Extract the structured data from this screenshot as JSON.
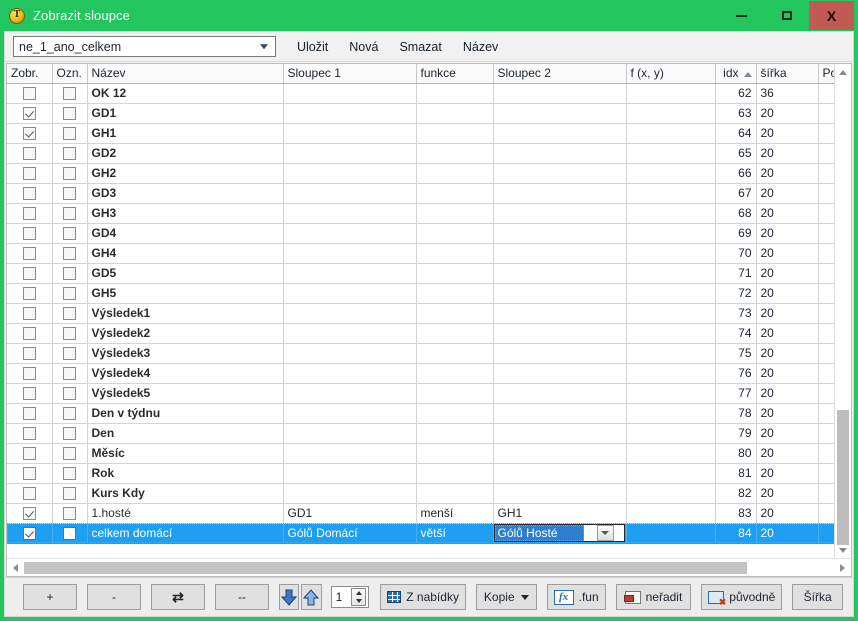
{
  "window": {
    "title": "Zobrazit sloupce",
    "icon": "coin-t-icon",
    "accent_green": "#22c55e",
    "selection_blue": "#1e9ff2",
    "buttons": {
      "minimize": "minimize-icon",
      "maximize": "maximize-icon",
      "close": "close-icon",
      "close_label": "X"
    }
  },
  "toolbar": {
    "profile_combo_value": "ne_1_ano_celkem",
    "save_label": "Uložit",
    "new_label": "Nová",
    "delete_label": "Smazat",
    "name_label": "Název"
  },
  "grid": {
    "columns": [
      {
        "key": "zobr",
        "label": "Zobr.",
        "align": "left"
      },
      {
        "key": "ozn",
        "label": "Ozn.",
        "align": "left"
      },
      {
        "key": "nazev",
        "label": "Název",
        "align": "left"
      },
      {
        "key": "s1",
        "label": "Sloupec 1",
        "align": "left"
      },
      {
        "key": "fn",
        "label": "funkce",
        "align": "left"
      },
      {
        "key": "s2",
        "label": "Sloupec 2",
        "align": "left"
      },
      {
        "key": "fxy",
        "label": "f (x, y)",
        "align": "left"
      },
      {
        "key": "idx",
        "label": "idx",
        "align": "right",
        "sorted": "asc"
      },
      {
        "key": "sirka",
        "label": "šířka",
        "align": "left"
      },
      {
        "key": "po",
        "label": "Po",
        "align": "left"
      }
    ],
    "rows": [
      {
        "zobr": false,
        "ozn": false,
        "nazev": "OK 12",
        "s1": "",
        "fn": "",
        "s2": "",
        "fxy": "",
        "idx": "62",
        "sirka": "36",
        "po": "",
        "bold": true,
        "selected": false
      },
      {
        "zobr": true,
        "ozn": false,
        "nazev": "GD1",
        "s1": "",
        "fn": "",
        "s2": "",
        "fxy": "",
        "idx": "63",
        "sirka": "20",
        "po": "",
        "bold": true,
        "selected": false
      },
      {
        "zobr": true,
        "ozn": false,
        "nazev": "GH1",
        "s1": "",
        "fn": "",
        "s2": "",
        "fxy": "",
        "idx": "64",
        "sirka": "20",
        "po": "",
        "bold": true,
        "selected": false
      },
      {
        "zobr": false,
        "ozn": false,
        "nazev": "GD2",
        "s1": "",
        "fn": "",
        "s2": "",
        "fxy": "",
        "idx": "65",
        "sirka": "20",
        "po": "",
        "bold": true,
        "selected": false
      },
      {
        "zobr": false,
        "ozn": false,
        "nazev": "GH2",
        "s1": "",
        "fn": "",
        "s2": "",
        "fxy": "",
        "idx": "66",
        "sirka": "20",
        "po": "",
        "bold": true,
        "selected": false
      },
      {
        "zobr": false,
        "ozn": false,
        "nazev": "GD3",
        "s1": "",
        "fn": "",
        "s2": "",
        "fxy": "",
        "idx": "67",
        "sirka": "20",
        "po": "",
        "bold": true,
        "selected": false
      },
      {
        "zobr": false,
        "ozn": false,
        "nazev": "GH3",
        "s1": "",
        "fn": "",
        "s2": "",
        "fxy": "",
        "idx": "68",
        "sirka": "20",
        "po": "",
        "bold": true,
        "selected": false
      },
      {
        "zobr": false,
        "ozn": false,
        "nazev": "GD4",
        "s1": "",
        "fn": "",
        "s2": "",
        "fxy": "",
        "idx": "69",
        "sirka": "20",
        "po": "",
        "bold": true,
        "selected": false
      },
      {
        "zobr": false,
        "ozn": false,
        "nazev": "GH4",
        "s1": "",
        "fn": "",
        "s2": "",
        "fxy": "",
        "idx": "70",
        "sirka": "20",
        "po": "",
        "bold": true,
        "selected": false
      },
      {
        "zobr": false,
        "ozn": false,
        "nazev": "GD5",
        "s1": "",
        "fn": "",
        "s2": "",
        "fxy": "",
        "idx": "71",
        "sirka": "20",
        "po": "",
        "bold": true,
        "selected": false
      },
      {
        "zobr": false,
        "ozn": false,
        "nazev": "GH5",
        "s1": "",
        "fn": "",
        "s2": "",
        "fxy": "",
        "idx": "72",
        "sirka": "20",
        "po": "",
        "bold": true,
        "selected": false
      },
      {
        "zobr": false,
        "ozn": false,
        "nazev": "Výsledek1",
        "s1": "",
        "fn": "",
        "s2": "",
        "fxy": "",
        "idx": "73",
        "sirka": "20",
        "po": "",
        "bold": true,
        "selected": false
      },
      {
        "zobr": false,
        "ozn": false,
        "nazev": "Výsledek2",
        "s1": "",
        "fn": "",
        "s2": "",
        "fxy": "",
        "idx": "74",
        "sirka": "20",
        "po": "",
        "bold": true,
        "selected": false
      },
      {
        "zobr": false,
        "ozn": false,
        "nazev": "Výsledek3",
        "s1": "",
        "fn": "",
        "s2": "",
        "fxy": "",
        "idx": "75",
        "sirka": "20",
        "po": "",
        "bold": true,
        "selected": false
      },
      {
        "zobr": false,
        "ozn": false,
        "nazev": "Výsledek4",
        "s1": "",
        "fn": "",
        "s2": "",
        "fxy": "",
        "idx": "76",
        "sirka": "20",
        "po": "",
        "bold": true,
        "selected": false
      },
      {
        "zobr": false,
        "ozn": false,
        "nazev": "Výsledek5",
        "s1": "",
        "fn": "",
        "s2": "",
        "fxy": "",
        "idx": "77",
        "sirka": "20",
        "po": "",
        "bold": true,
        "selected": false
      },
      {
        "zobr": false,
        "ozn": false,
        "nazev": "Den v týdnu",
        "s1": "",
        "fn": "",
        "s2": "",
        "fxy": "",
        "idx": "78",
        "sirka": "20",
        "po": "",
        "bold": true,
        "selected": false
      },
      {
        "zobr": false,
        "ozn": false,
        "nazev": "Den",
        "s1": "",
        "fn": "",
        "s2": "",
        "fxy": "",
        "idx": "79",
        "sirka": "20",
        "po": "",
        "bold": true,
        "selected": false
      },
      {
        "zobr": false,
        "ozn": false,
        "nazev": "Měsíc",
        "s1": "",
        "fn": "",
        "s2": "",
        "fxy": "",
        "idx": "80",
        "sirka": "20",
        "po": "",
        "bold": true,
        "selected": false
      },
      {
        "zobr": false,
        "ozn": false,
        "nazev": "Rok",
        "s1": "",
        "fn": "",
        "s2": "",
        "fxy": "",
        "idx": "81",
        "sirka": "20",
        "po": "",
        "bold": true,
        "selected": false
      },
      {
        "zobr": false,
        "ozn": false,
        "nazev": "Kurs Kdy",
        "s1": "",
        "fn": "",
        "s2": "",
        "fxy": "",
        "idx": "82",
        "sirka": "20",
        "po": "",
        "bold": true,
        "selected": false
      },
      {
        "zobr": true,
        "ozn": false,
        "nazev": "1.hosté",
        "s1": "GD1",
        "fn": "menší",
        "s2": "GH1",
        "fxy": "",
        "idx": "83",
        "sirka": "20",
        "po": "",
        "bold": false,
        "selected": false
      },
      {
        "zobr": true,
        "ozn": false,
        "nazev": "celkem domácí",
        "s1": "Gólů Domácí",
        "fn": "větší",
        "s2": "Gólů Hosté",
        "fxy": "",
        "idx": "84",
        "sirka": "20",
        "po": "",
        "bold": false,
        "selected": true,
        "editing_cell": "s2"
      }
    ]
  },
  "bottom_toolbar": {
    "add_label": "+",
    "remove_label": "-",
    "refresh_icon": "refresh-icon",
    "dashes_label": "--",
    "move_down_icon": "arrow-down-icon",
    "move_up_icon": "arrow-up-icon",
    "step_value": "1",
    "from_menu_label": "Z nabídky",
    "from_menu_icon": "table-icon",
    "copy_label": "Kopie",
    "fun_label": ".fun",
    "fun_icon": "fx-icon",
    "unsort_label": "neřadit",
    "unsort_icon": "sort-clear-icon",
    "original_label": "původně",
    "original_icon": "restore-icon",
    "width_label": "Šířka"
  },
  "scrollbars": {
    "vertical": {
      "thumb_position": "bottom",
      "up_icon": "scroll-up-icon",
      "down_icon": "scroll-down-icon"
    },
    "horizontal": {
      "thumb_position": "left",
      "left_icon": "scroll-left-icon",
      "right_icon": "scroll-right-icon"
    }
  }
}
